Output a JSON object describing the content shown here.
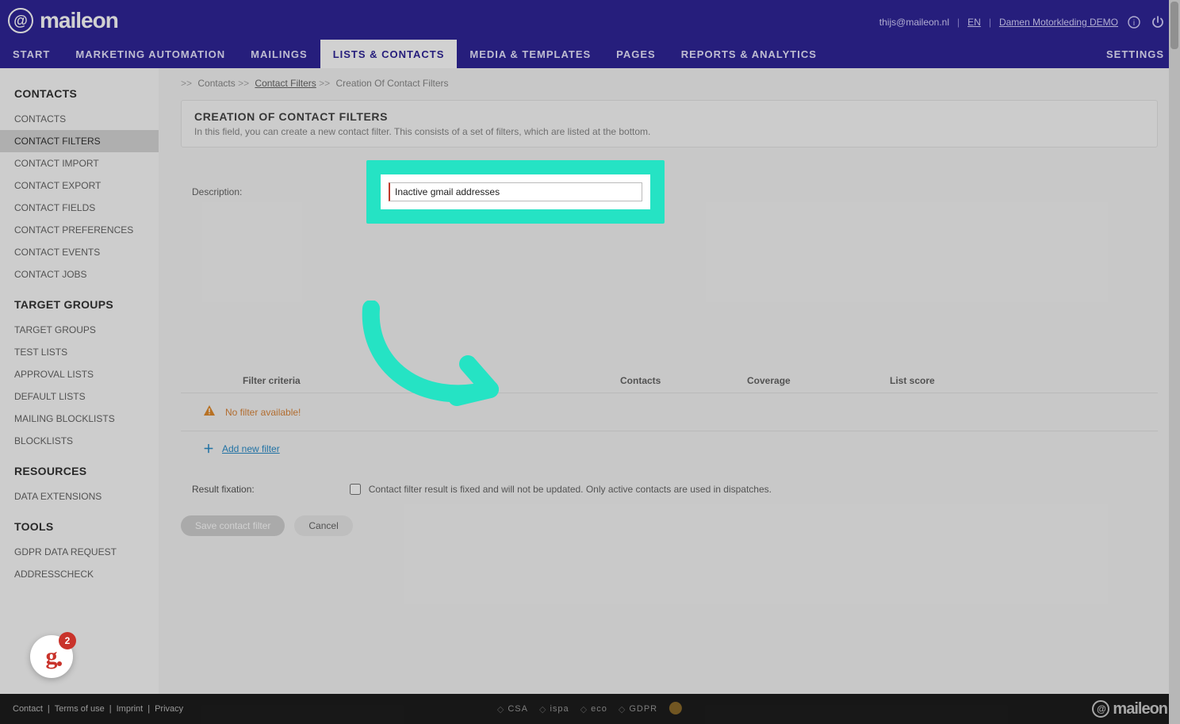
{
  "brand": "maileon",
  "header": {
    "user_email": "thijs@maileon.nl",
    "lang": "EN",
    "account_link": "Damen Motorkleding DEMO"
  },
  "nav": {
    "items": [
      "START",
      "MARKETING AUTOMATION",
      "MAILINGS",
      "LISTS & CONTACTS",
      "MEDIA & TEMPLATES",
      "PAGES",
      "REPORTS & ANALYTICS"
    ],
    "active_index": 3,
    "settings": "SETTINGS"
  },
  "sidebar": {
    "sections": [
      {
        "title": "CONTACTS",
        "items": [
          "CONTACTS",
          "CONTACT FILTERS",
          "CONTACT IMPORT",
          "CONTACT EXPORT",
          "CONTACT FIELDS",
          "CONTACT PREFERENCES",
          "CONTACT EVENTS",
          "CONTACT JOBS"
        ],
        "active_index": 1
      },
      {
        "title": "TARGET GROUPS",
        "items": [
          "TARGET GROUPS",
          "TEST LISTS",
          "APPROVAL LISTS",
          "DEFAULT LISTS",
          "MAILING BLOCKLISTS",
          "BLOCKLISTS"
        ]
      },
      {
        "title": "RESOURCES",
        "items": [
          "DATA EXTENSIONS"
        ]
      },
      {
        "title": "TOOLS",
        "items": [
          "GDPR DATA REQUEST",
          "ADDRESSCHECK"
        ]
      }
    ]
  },
  "breadcrumb": {
    "items": [
      {
        "label": "Contacts",
        "link": false
      },
      {
        "label": "Contact Filters",
        "link": true
      },
      {
        "label": "Creation Of Contact Filters",
        "link": false
      }
    ]
  },
  "page": {
    "title": "CREATION OF CONTACT FILTERS",
    "subtitle": "In this field, you can create a new contact filter. This consists of a set of filters, which are listed at the bottom."
  },
  "form": {
    "description_label": "Description:",
    "description_value": "Inactive gmail addresses",
    "table": {
      "columns": [
        "Filter criteria",
        "Contacts",
        "Coverage",
        "List score"
      ],
      "empty_text": "No filter available!",
      "add_new_label": "Add new filter"
    },
    "fixation": {
      "label": "Result fixation:",
      "checked": false,
      "text": "Contact filter result is fixed and will not be updated. Only active contacts are used in dispatches."
    },
    "save_btn": "Save contact filter",
    "cancel_btn": "Cancel"
  },
  "bubble_badge": "2",
  "footer": {
    "links": [
      "Contact",
      "Terms of use",
      "Imprint",
      "Privacy"
    ],
    "badges": [
      "CSA",
      "ispa",
      "eco",
      "GDPR"
    ]
  }
}
